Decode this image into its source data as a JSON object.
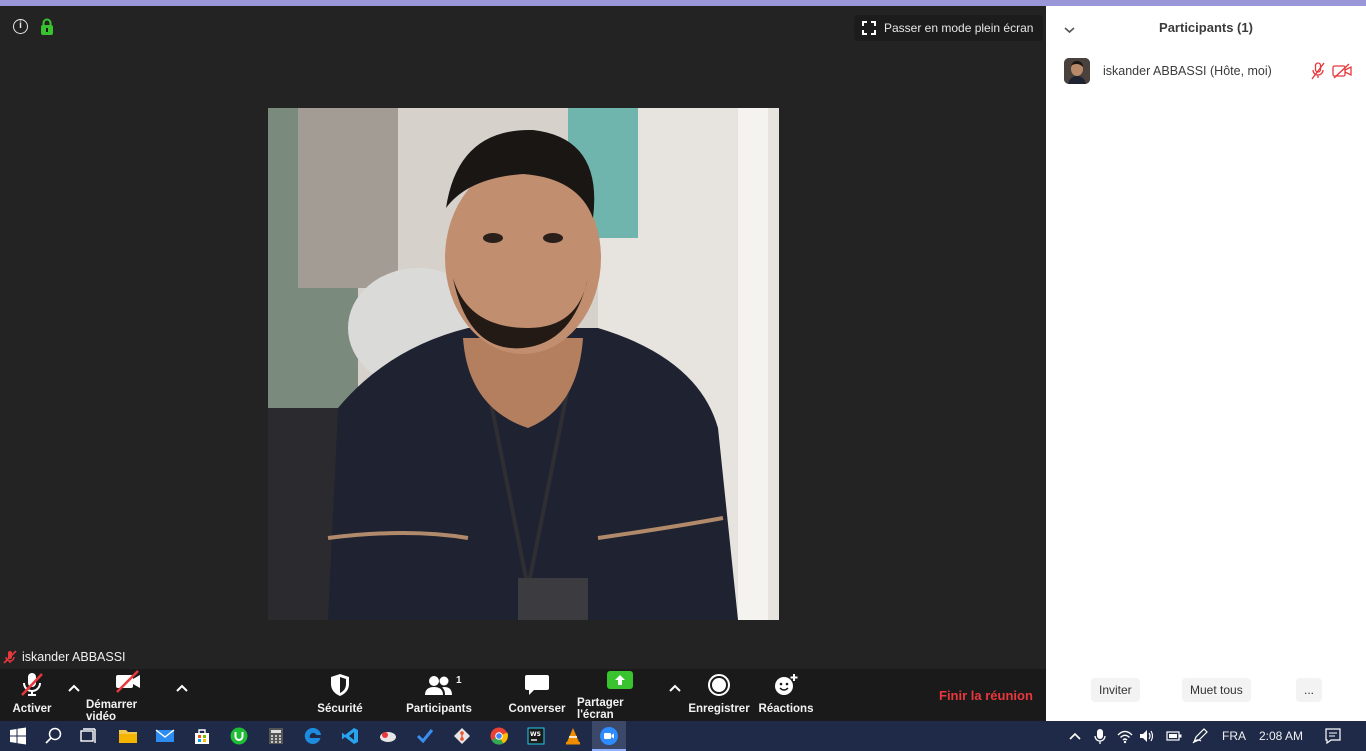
{
  "meeting": {
    "fullscreen_label": "Passer en mode plein écran",
    "video_name": "iskander ABBASSI"
  },
  "toolbar": {
    "mute_label": "Activer",
    "video_label": "Démarrer vidéo",
    "security_label": "Sécurité",
    "participants_label": "Participants",
    "participants_count": "1",
    "chat_label": "Converser",
    "share_label": "Partager l'écran",
    "record_label": "Enregistrer",
    "reactions_label": "Réactions",
    "end_label": "Finir la réunion"
  },
  "panel": {
    "title": "Participants (1)",
    "participants": [
      {
        "name": "iskander ABBASSI (Hôte, moi)"
      }
    ],
    "invite_label": "Inviter",
    "mute_all_label": "Muet tous",
    "more_label": "..."
  },
  "taskbar": {
    "language": "FRA",
    "time": "2:08 AM"
  },
  "colors": {
    "end_red": "#e8383d",
    "share_green": "#39c42f",
    "panel_bg": "#ffffff",
    "taskbar_bg": "#1e2a48"
  }
}
